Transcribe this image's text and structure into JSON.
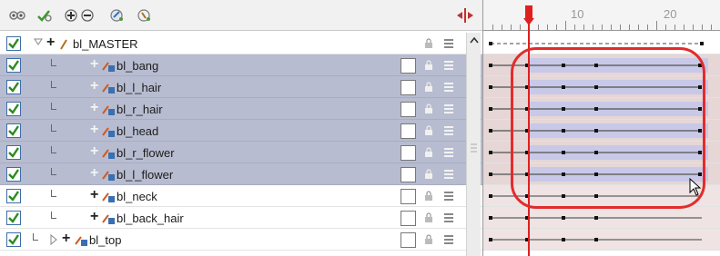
{
  "toolbar": {
    "buttons": [
      {
        "name": "show-all-icon",
        "label": ""
      },
      {
        "name": "toggle-layers-icon",
        "label": ""
      },
      {
        "name": "add-remove-layers-icon",
        "label": ""
      },
      {
        "name": "drawing-layer-icon",
        "label": ""
      },
      {
        "name": "peg-layer-icon",
        "label": ""
      }
    ],
    "split_icon": "split-timeline-icon"
  },
  "ruler": {
    "labels": [
      "10",
      "20"
    ]
  },
  "layers": [
    {
      "name": "bl_MASTER",
      "type": "master",
      "checked": true,
      "selected": false
    },
    {
      "name": "bl_bang",
      "type": "drawing",
      "checked": true,
      "selected": true
    },
    {
      "name": "bl_l_hair",
      "type": "drawing",
      "checked": true,
      "selected": true
    },
    {
      "name": "bl_r_hair",
      "type": "drawing",
      "checked": true,
      "selected": true
    },
    {
      "name": "bl_head",
      "type": "drawing",
      "checked": true,
      "selected": true
    },
    {
      "name": "bl_r_flower",
      "type": "drawing",
      "checked": true,
      "selected": true
    },
    {
      "name": "bl_l_flower",
      "type": "drawing",
      "checked": true,
      "selected": true
    },
    {
      "name": "bl_neck",
      "type": "drawing",
      "checked": true,
      "selected": false
    },
    {
      "name": "bl_back_hair",
      "type": "drawing",
      "checked": true,
      "selected": false
    },
    {
      "name": "bl_top",
      "type": "drawing",
      "checked": true,
      "selected": false
    }
  ],
  "colors": {
    "selected_row": "#b8bcd0",
    "playhead": "#e02020",
    "annotation": "#e32b2b",
    "check_border": "#3e6ea8",
    "check_mark": "#2d8a1f"
  }
}
